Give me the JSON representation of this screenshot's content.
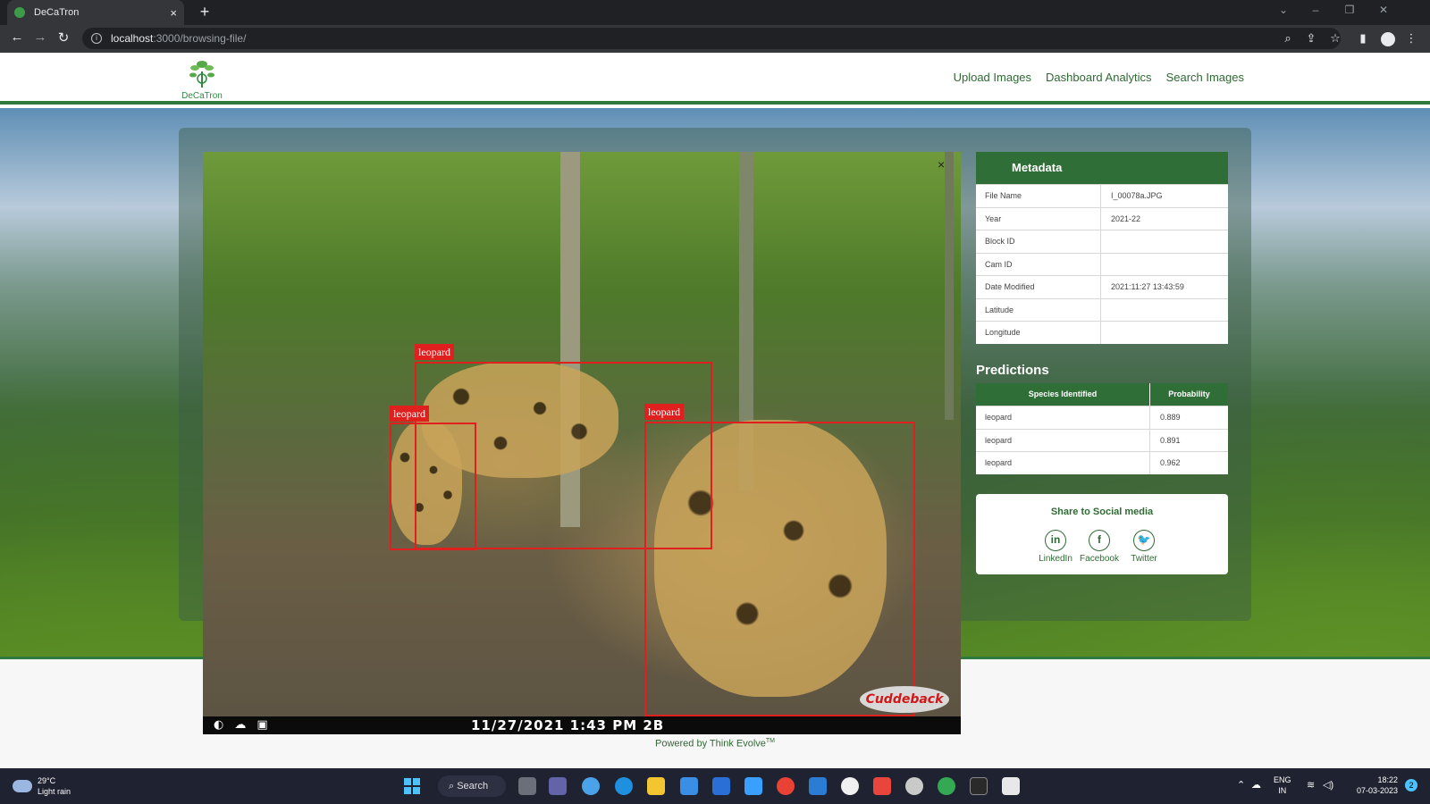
{
  "browser": {
    "tab_title": "DeCaTron",
    "tab_close": "×",
    "new_tab": "+",
    "url_host": "localhost",
    "url_path": ":3000/browsing-file/",
    "info_icon": "i"
  },
  "site": {
    "logo_text": "DeCaTron",
    "nav": [
      "Upload Images",
      "Dashboard Analytics",
      "Search Images"
    ]
  },
  "viewer": {
    "close": "×",
    "detections": [
      {
        "label": "leopard"
      },
      {
        "label": "leopard"
      },
      {
        "label": "leopard"
      }
    ],
    "camera_stamp": "11/27/2021   1:43 PM   2B",
    "brand": "Cuddeback"
  },
  "metadata": {
    "title": "Metadata",
    "rows": [
      {
        "key": "File Name",
        "value": "I_00078a.JPG"
      },
      {
        "key": "Year",
        "value": "2021-22"
      },
      {
        "key": "Block ID",
        "value": ""
      },
      {
        "key": "Cam ID",
        "value": ""
      },
      {
        "key": "Date Modified",
        "value": "2021:11:27 13:43:59"
      },
      {
        "key": "Latitude",
        "value": ""
      },
      {
        "key": "Longitude",
        "value": ""
      }
    ]
  },
  "predictions": {
    "title": "Predictions",
    "headers": [
      "Species Identified",
      "Probability"
    ],
    "rows": [
      {
        "species": "leopard",
        "probability": "0.889"
      },
      {
        "species": "leopard",
        "probability": "0.891"
      },
      {
        "species": "leopard",
        "probability": "0.962"
      }
    ]
  },
  "share": {
    "title": "Share to Social media",
    "items": [
      {
        "glyph": "in",
        "label": "LinkedIn"
      },
      {
        "glyph": "f",
        "label": "Facebook"
      },
      {
        "glyph": "🐦",
        "label": "Twitter"
      }
    ]
  },
  "footer": {
    "powered": "Powered by Think Evolve",
    "tm": "TM"
  },
  "taskbar": {
    "temp": "29°C",
    "weather": "Light rain",
    "search": "Search",
    "lang": "ENG",
    "region": "IN",
    "time": "18:22",
    "date": "07-03-2023",
    "notif": "2"
  },
  "colors": {
    "brand_green": "#2f6e37",
    "bbox_red": "#e0201f"
  }
}
